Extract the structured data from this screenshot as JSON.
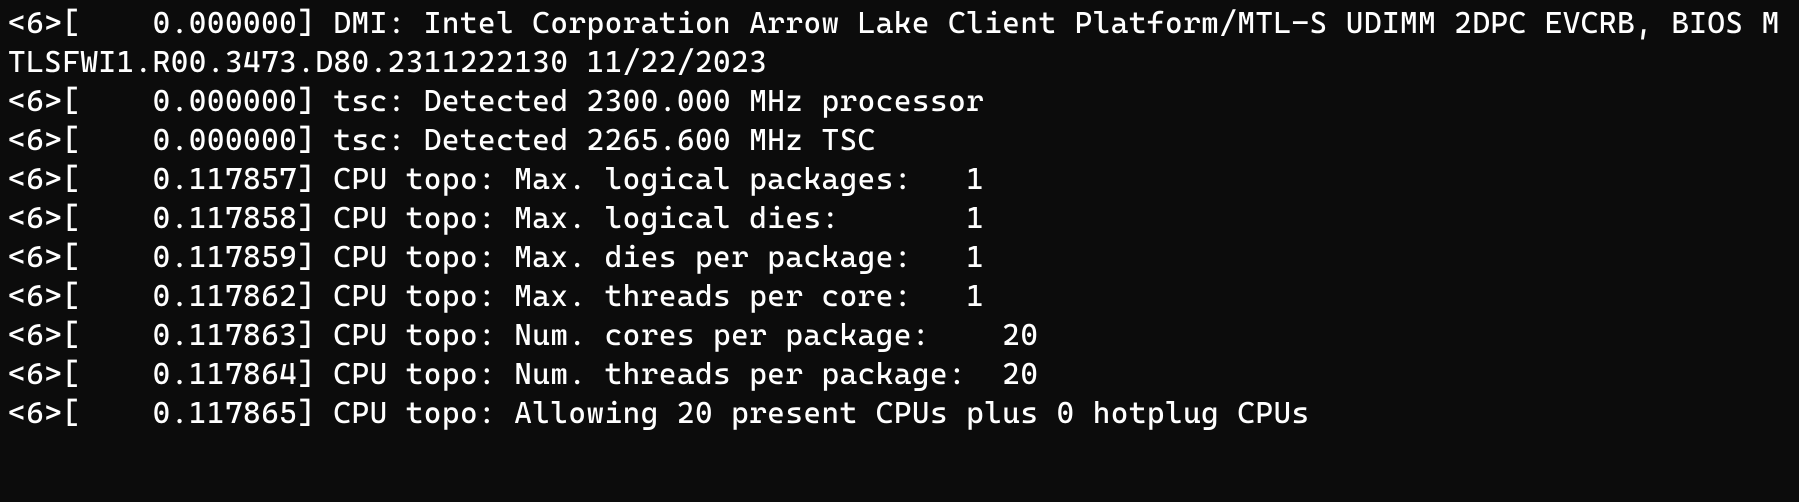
{
  "lines": [
    "<6>[    0.000000] DMI: Intel Corporation Arrow Lake Client Platform/MTL-S UDIMM 2DPC EVCRB, BIOS MTLSFWI1.R00.3473.D80.2311222130 11/22/2023",
    "<6>[    0.000000] tsc: Detected 2300.000 MHz processor",
    "<6>[    0.000000] tsc: Detected 2265.600 MHz TSC",
    "<6>[    0.117857] CPU topo: Max. logical packages:   1",
    "<6>[    0.117858] CPU topo: Max. logical dies:       1",
    "<6>[    0.117859] CPU topo: Max. dies per package:   1",
    "<6>[    0.117862] CPU topo: Max. threads per core:   1",
    "<6>[    0.117863] CPU topo: Num. cores per package:    20",
    "<6>[    0.117864] CPU topo: Num. threads per package:  20",
    "<6>[    0.117865] CPU topo: Allowing 20 present CPUs plus 0 hotplug CPUs"
  ]
}
